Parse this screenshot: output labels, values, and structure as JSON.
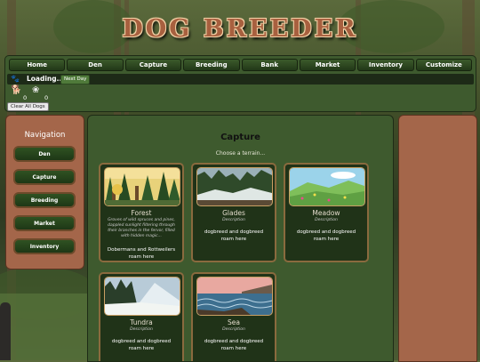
{
  "app": {
    "title": "DOG BREEDER"
  },
  "menu": [
    "Home",
    "Den",
    "Capture",
    "Breeding",
    "Bank",
    "Market",
    "Inventory",
    "Customize"
  ],
  "status": {
    "loading": "Loading...",
    "next_day": "Next Day",
    "count_a": "0",
    "count_b": "0",
    "clear_all": "Clear All Dogs"
  },
  "nav": {
    "title": "Navigation",
    "items": [
      "Den",
      "Capture",
      "Breeding",
      "Market",
      "Inventory"
    ]
  },
  "capture": {
    "heading": "Capture",
    "subtitle": "Choose a terrain...",
    "terrains": [
      {
        "name": "Forest",
        "desc": "Groves of wild spruces and pines, dappled sunlight filtering through their branches in the fervor, filled with hidden magic...",
        "roam": "Dobermans and Rottweilers roam here"
      },
      {
        "name": "Glades",
        "desc": "Description",
        "roam": "dogbreed and dogbreed roam here"
      },
      {
        "name": "Meadow",
        "desc": "Description",
        "roam": "dogbreed and dogbreed roam here"
      },
      {
        "name": "Tundra",
        "desc": "Description",
        "roam": "dogbreed and dogbreed roam here"
      },
      {
        "name": "Sea",
        "desc": "Description",
        "roam": "dogbreed and dogbreed roam here"
      }
    ]
  },
  "colors": {
    "panel_green": "#3e5a2e",
    "panel_brown": "#a4664a",
    "title": "#a8603f",
    "card_border": "#8a6a3e"
  }
}
